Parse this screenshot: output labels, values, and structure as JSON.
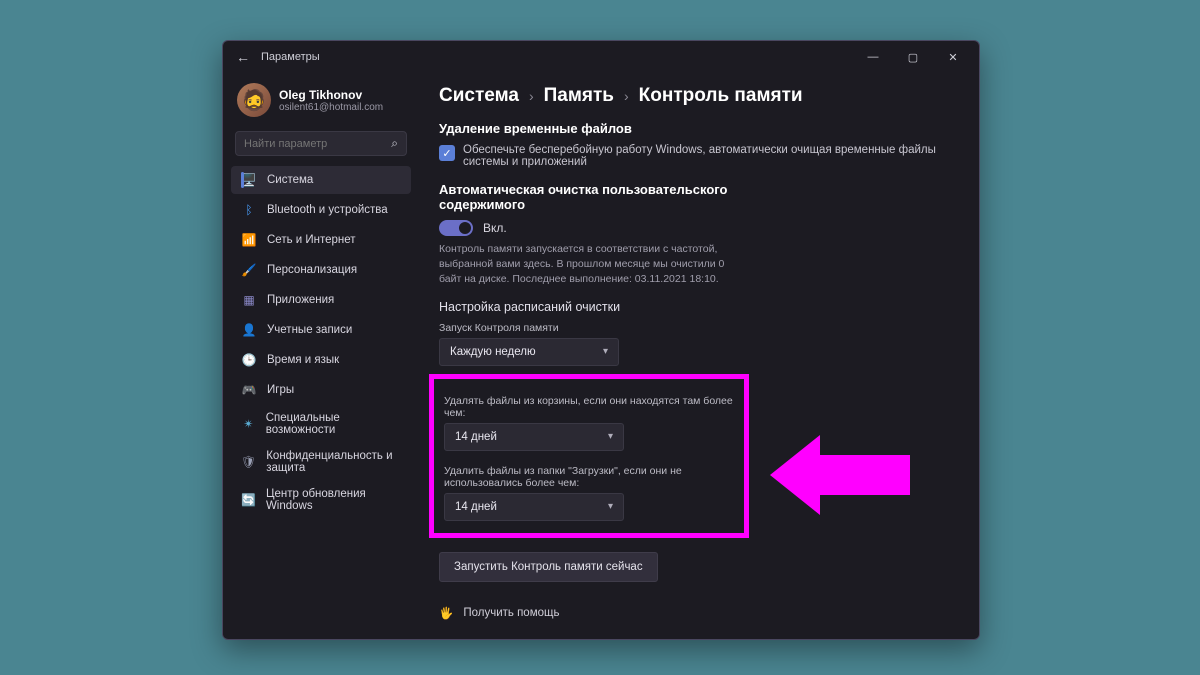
{
  "window": {
    "app_title": "Параметры"
  },
  "profile": {
    "name": "Oleg Tikhonov",
    "email": "osilent61@hotmail.com"
  },
  "search": {
    "placeholder": "Найти параметр"
  },
  "sidebar": {
    "items": [
      {
        "icon": "🖥️",
        "label": "Система"
      },
      {
        "icon": "ᛒ",
        "label": "Bluetooth и устройства",
        "color": "#4aa0ff"
      },
      {
        "icon": "📶",
        "label": "Сеть и Интернет",
        "color": "#23c6d8"
      },
      {
        "icon": "🖌️",
        "label": "Персонализация",
        "color": "#d97c3a"
      },
      {
        "icon": "▦",
        "label": "Приложения",
        "color": "#8a88c7"
      },
      {
        "icon": "👤",
        "label": "Учетные записи",
        "color": "#6fb6d6"
      },
      {
        "icon": "🕒",
        "label": "Время и язык",
        "color": "#d98a5a"
      },
      {
        "icon": "🎮",
        "label": "Игры",
        "color": "#9a98a5"
      },
      {
        "icon": "✴",
        "label": "Специальные возможности",
        "color": "#5cb0d8"
      },
      {
        "icon": "🛡",
        "label": "Конфиденциальность и защита",
        "color": "#9aa0b5"
      },
      {
        "icon": "🔄",
        "label": "Центр обновления Windows",
        "color": "#3a8fd6"
      }
    ]
  },
  "breadcrumb": {
    "l1": "Система",
    "l2": "Память",
    "l3": "Контроль памяти"
  },
  "temp": {
    "heading": "Удаление временные файлов",
    "check_label": "Обеспечьте бесперебойную работу Windows, автоматически очищая временные файлы системы и приложений"
  },
  "auto": {
    "heading": "Автоматическая очистка пользовательского содержимого",
    "toggle_label": "Вкл.",
    "description": "Контроль памяти запускается в соответствии с частотой, выбранной вами здесь. В прошлом месяце мы очистили 0 байт на диске. Последнее выполнение: 03.11.2021 18:10."
  },
  "schedule": {
    "heading": "Настройка расписаний очистки",
    "run_label": "Запуск Контроля памяти",
    "run_value": "Каждую неделю",
    "recycle_label": "Удалять файлы из корзины, если они находятся там более чем:",
    "recycle_value": "14 дней",
    "downloads_label": "Удалить файлы из папки \"Загрузки\", если они не использовались более чем:",
    "downloads_value": "14 дней"
  },
  "run_now": "Запустить Контроль памяти сейчас",
  "help": "Получить помощь"
}
